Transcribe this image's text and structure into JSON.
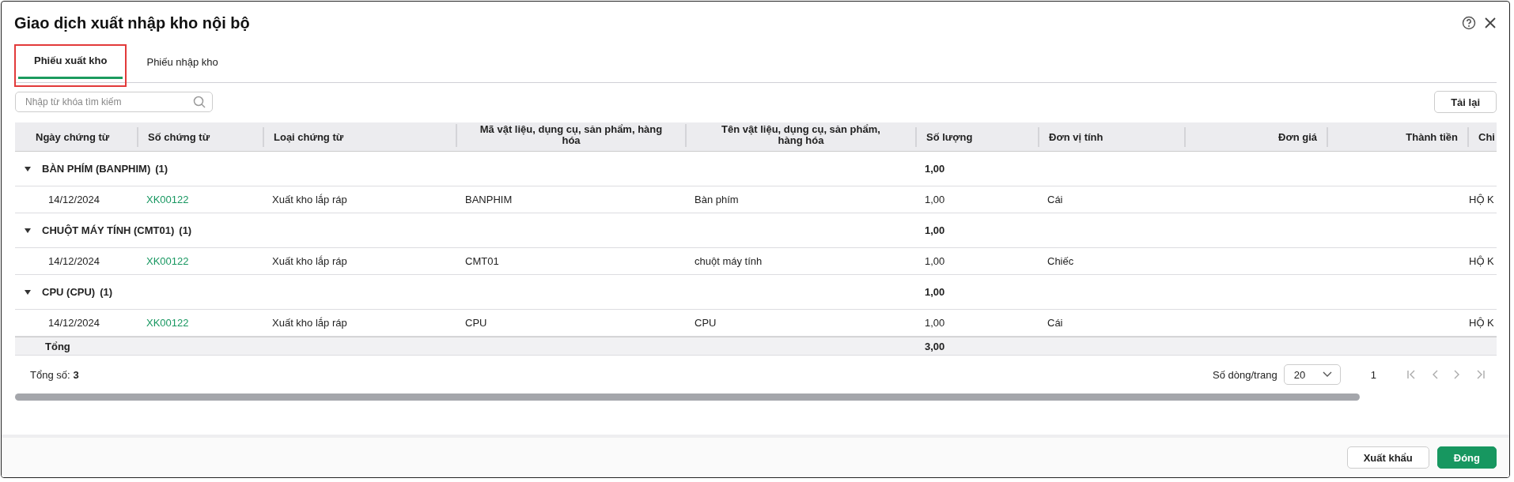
{
  "window": {
    "title": "Giao dịch xuất nhập kho nội bộ"
  },
  "tabs": [
    {
      "label": "Phiếu xuất kho",
      "selected": true,
      "highlighted": true
    },
    {
      "label": "Phiếu nhập kho",
      "selected": false,
      "highlighted": false
    }
  ],
  "search": {
    "placeholder": "Nhập từ khóa tìm kiếm"
  },
  "reload_button": "Tải lại",
  "table": {
    "columns": [
      {
        "label": "Ngày chứng từ"
      },
      {
        "label": "Số chứng từ"
      },
      {
        "label": "Loại chứng từ"
      },
      {
        "label": "Mã vật liệu, dụng cụ, sản phẩm, hàng hóa"
      },
      {
        "label": "Tên vật liệu, dụng cụ, sản phẩm, hàng hóa"
      },
      {
        "label": "Số lượng"
      },
      {
        "label": "Đơn vị tính"
      },
      {
        "label": "Đơn giá"
      },
      {
        "label": "Thành tiền"
      },
      {
        "label": "Chi"
      }
    ],
    "groups": [
      {
        "title": "BÀN PHÍM (BANPHIM)",
        "count": "(1)",
        "expanded": true,
        "quantity": "1,00",
        "rows": [
          {
            "date": "14/12/2024",
            "number": "XK00122",
            "type": "Xuất kho lắp ráp",
            "code": "BANPHIM",
            "name": "Bàn phím",
            "quantity": "1,00",
            "unit": "Cái",
            "column_10": "HỘ K"
          }
        ]
      },
      {
        "title": "CHUỘT MÁY TÍNH (CMT01)",
        "count": "(1)",
        "expanded": true,
        "quantity": "1,00",
        "rows": [
          {
            "date": "14/12/2024",
            "number": "XK00122",
            "type": "Xuất kho lắp ráp",
            "code": "CMT01",
            "name": "chuột máy tính",
            "quantity": "1,00",
            "unit": "Chiếc",
            "column_10": "HỘ K"
          }
        ]
      },
      {
        "title": "CPU (CPU)",
        "count": "(1)",
        "expanded": true,
        "quantity": "1,00",
        "rows": [
          {
            "date": "14/12/2024",
            "number": "XK00122",
            "type": "Xuất kho lắp ráp",
            "code": "CPU",
            "name": "CPU",
            "quantity": "1,00",
            "unit": "Cái",
            "column_10": "HỘ K"
          }
        ]
      }
    ],
    "total": {
      "label": "Tổng",
      "quantity": "3,00"
    }
  },
  "footer": {
    "total_label": "Tổng số:",
    "total_value": "3",
    "page_size_label": "Số dòng/trang",
    "page_size": "20",
    "page": "1"
  },
  "buttons": [
    {
      "label": "Xuất khẩu",
      "kind": "secondary"
    },
    {
      "label": "Đóng",
      "kind": "primary"
    }
  ]
}
